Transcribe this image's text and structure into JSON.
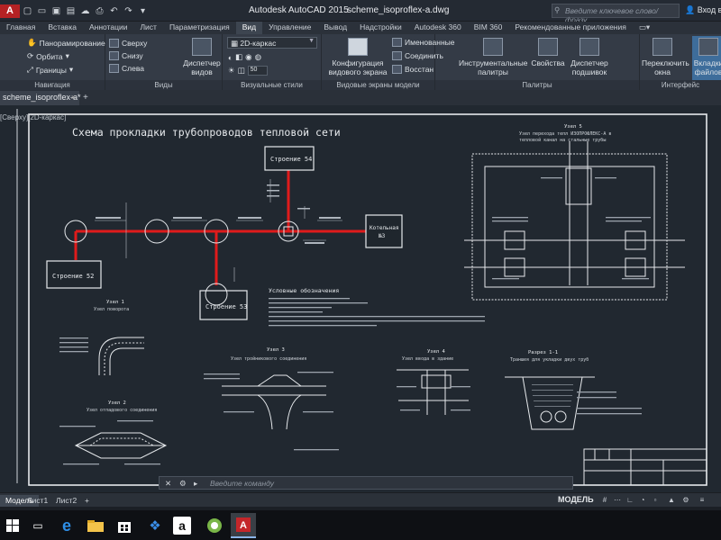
{
  "titlebar": {
    "app_title": "Autodesk AutoCAD 2015",
    "file_name": "scheme_isoproflex-a.dwg",
    "search_placeholder": "Введите ключевое слово/фразу",
    "sign_in": "Вход в службы"
  },
  "ribbon_tabs": [
    "Главная",
    "Вставка",
    "Аннотации",
    "Лист",
    "Параметризация",
    "Вид",
    "Управление",
    "Вывод",
    "Надстройки",
    "Autodesk 360",
    "BIM 360",
    "Рекомендованные приложения"
  ],
  "active_ribbon_tab": "Вид",
  "ribbon": {
    "navigation": {
      "pan": "Панорамирование",
      "orbit": "Орбита",
      "bounds": "Границы",
      "label": "Навигация"
    },
    "views": {
      "items": [
        "Сверху",
        "Снизу",
        "Слева"
      ],
      "manager": "Диспетчер видов",
      "label": "Виды"
    },
    "visual_styles": {
      "current": "2D-каркас",
      "zoom_value": "50",
      "label": "Визуальные стили"
    },
    "viewports": {
      "config": "Конфигурация видового экрана",
      "named": "Именованные",
      "join": "Соединить",
      "restore": "Восстан",
      "label": "Видовые экраны модели"
    },
    "palettes": {
      "tool_palettes": "Инструментальные палитры",
      "properties": "Свойства",
      "sheet_manager": "Диспетчер подшивок",
      "label": "Палитры"
    },
    "interface": {
      "switch_windows": "Переключить окна",
      "file_tabs": "Вкладки файлов",
      "label": "Интерфейс"
    }
  },
  "document_tab": "scheme_isoproflex-a*",
  "view_label": "[Сверху][2D-каркас]",
  "drawing": {
    "title": "Схема прокладки трубопроводов тепловой сети",
    "buildings": [
      "Строение 54",
      "Строение 52",
      "Строение 53"
    ],
    "boiler_line1": "Котельная",
    "boiler_line2": "№3",
    "legend_title": "Условные обозначения",
    "node1_title": "Узел 1",
    "node1_sub": "Узел поворота",
    "node2_title": "Узел 2",
    "node2_sub": "Узел отпадового соединения",
    "node3_title": "Узел 3",
    "node3_sub": "Узел тройникового соединения",
    "node4_title": "Узел 4",
    "node4_sub": "Узел ввода в здание",
    "node5_title": "Узел 5",
    "node5_sub1": "Узел перехода тепл ИЗОПРОФЛЕКС-А в",
    "node5_sub2": "тепловой канал на стальные трубы",
    "section_title": "Разрез 1-1",
    "section_sub": "Траншея для укладки двух труб"
  },
  "command_placeholder": "Введите команду",
  "layout_tabs": [
    "Модель",
    "Лист1",
    "Лист2"
  ],
  "active_layout": "Модель",
  "status": {
    "model": "МОДЕЛЬ"
  },
  "colors": {
    "pipe": "#e01b1b",
    "accent": "#3d87c8",
    "canvas": "#212830"
  }
}
